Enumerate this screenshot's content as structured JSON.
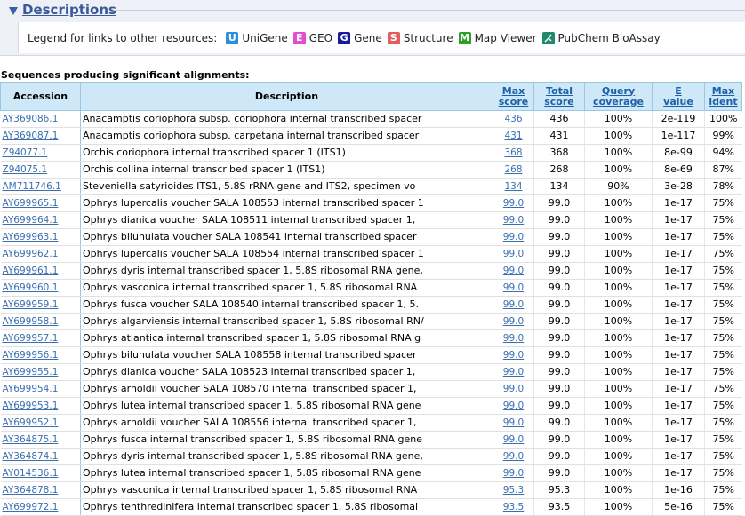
{
  "section": {
    "title": "Descriptions"
  },
  "legend": {
    "label": "Legend for links to other resources:",
    "items": [
      {
        "letter": "U",
        "label": "UniGene",
        "color": "#2b8fe0"
      },
      {
        "letter": "E",
        "label": "GEO",
        "color": "#e04fd0"
      },
      {
        "letter": "G",
        "label": "Gene",
        "color": "#1a1a9c"
      },
      {
        "letter": "S",
        "label": "Structure",
        "color": "#e25d5d"
      },
      {
        "letter": "M",
        "label": "Map Viewer",
        "color": "#2aa02a"
      },
      {
        "letter": "",
        "label": "PubChem BioAssay",
        "color": "#1f8a6a"
      }
    ]
  },
  "significant_title": "Sequences producing significant alignments:",
  "columns": {
    "accession": "Accession",
    "description": "Description",
    "max_score": [
      "Max",
      "score"
    ],
    "total_score": [
      "Total",
      "score"
    ],
    "query_coverage": [
      "Query",
      "coverage"
    ],
    "e_value": [
      "E",
      "value"
    ],
    "max_ident": [
      "Max",
      "ident"
    ]
  },
  "rows": [
    {
      "acc": "AY369086.1",
      "desc": "Anacamptis coriophora subsp. coriophora internal transcribed spacer",
      "max": "436",
      "total": "436",
      "cov": "100%",
      "e": "2e-119",
      "ident": "100%"
    },
    {
      "acc": "AY369087.1",
      "desc": "Anacamptis coriophora subsp. carpetana internal transcribed spacer",
      "max": "431",
      "total": "431",
      "cov": "100%",
      "e": "1e-117",
      "ident": "99%"
    },
    {
      "acc": "Z94077.1",
      "desc": "Orchis coriophora internal transcribed spacer 1 (ITS1)",
      "max": "368",
      "total": "368",
      "cov": "100%",
      "e": "8e-99",
      "ident": "94%"
    },
    {
      "acc": "Z94075.1",
      "desc": "Orchis collina internal transcribed spacer 1 (ITS1)",
      "max": "268",
      "total": "268",
      "cov": "100%",
      "e": "8e-69",
      "ident": "87%"
    },
    {
      "acc": "AM711746.1",
      "desc": "Steveniella satyrioides ITS1, 5.8S rRNA gene and ITS2, specimen vo",
      "max": "134",
      "total": "134",
      "cov": "90%",
      "e": "3e-28",
      "ident": "78%"
    },
    {
      "acc": "AY699965.1",
      "desc": "Ophrys lupercalis voucher SALA 108553 internal transcribed spacer 1",
      "max": "99.0",
      "total": "99.0",
      "cov": "100%",
      "e": "1e-17",
      "ident": "75%"
    },
    {
      "acc": "AY699964.1",
      "desc": "Ophrys dianica voucher SALA 108511 internal transcribed spacer 1,",
      "max": "99.0",
      "total": "99.0",
      "cov": "100%",
      "e": "1e-17",
      "ident": "75%"
    },
    {
      "acc": "AY699963.1",
      "desc": "Ophrys bilunulata voucher SALA 108541 internal transcribed spacer",
      "max": "99.0",
      "total": "99.0",
      "cov": "100%",
      "e": "1e-17",
      "ident": "75%"
    },
    {
      "acc": "AY699962.1",
      "desc": "Ophrys lupercalis voucher SALA 108554 internal transcribed spacer 1",
      "max": "99.0",
      "total": "99.0",
      "cov": "100%",
      "e": "1e-17",
      "ident": "75%"
    },
    {
      "acc": "AY699961.1",
      "desc": "Ophrys dyris internal transcribed spacer 1, 5.8S ribosomal RNA gene,",
      "max": "99.0",
      "total": "99.0",
      "cov": "100%",
      "e": "1e-17",
      "ident": "75%"
    },
    {
      "acc": "AY699960.1",
      "desc": "Ophrys vasconica internal transcribed spacer 1, 5.8S ribosomal RNA",
      "max": "99.0",
      "total": "99.0",
      "cov": "100%",
      "e": "1e-17",
      "ident": "75%"
    },
    {
      "acc": "AY699959.1",
      "desc": "Ophrys fusca voucher SALA 108540 internal transcribed spacer 1, 5.",
      "max": "99.0",
      "total": "99.0",
      "cov": "100%",
      "e": "1e-17",
      "ident": "75%"
    },
    {
      "acc": "AY699958.1",
      "desc": "Ophrys algarviensis internal transcribed spacer 1, 5.8S ribosomal RN/",
      "max": "99.0",
      "total": "99.0",
      "cov": "100%",
      "e": "1e-17",
      "ident": "75%"
    },
    {
      "acc": "AY699957.1",
      "desc": "Ophrys atlantica internal transcribed spacer 1, 5.8S ribosomal RNA g",
      "max": "99.0",
      "total": "99.0",
      "cov": "100%",
      "e": "1e-17",
      "ident": "75%"
    },
    {
      "acc": "AY699956.1",
      "desc": "Ophrys bilunulata voucher SALA 108558 internal transcribed spacer",
      "max": "99.0",
      "total": "99.0",
      "cov": "100%",
      "e": "1e-17",
      "ident": "75%"
    },
    {
      "acc": "AY699955.1",
      "desc": "Ophrys dianica voucher SALA 108523 internal transcribed spacer 1,",
      "max": "99.0",
      "total": "99.0",
      "cov": "100%",
      "e": "1e-17",
      "ident": "75%"
    },
    {
      "acc": "AY699954.1",
      "desc": "Ophrys arnoldii voucher SALA 108570 internal transcribed spacer 1,",
      "max": "99.0",
      "total": "99.0",
      "cov": "100%",
      "e": "1e-17",
      "ident": "75%"
    },
    {
      "acc": "AY699953.1",
      "desc": "Ophrys lutea internal transcribed spacer 1, 5.8S ribosomal RNA gene",
      "max": "99.0",
      "total": "99.0",
      "cov": "100%",
      "e": "1e-17",
      "ident": "75%"
    },
    {
      "acc": "AY699952.1",
      "desc": "Ophrys arnoldii voucher SALA 108556 internal transcribed spacer 1,",
      "max": "99.0",
      "total": "99.0",
      "cov": "100%",
      "e": "1e-17",
      "ident": "75%"
    },
    {
      "acc": "AY364875.1",
      "desc": "Ophrys fusca internal transcribed spacer 1, 5.8S ribosomal RNA gene",
      "max": "99.0",
      "total": "99.0",
      "cov": "100%",
      "e": "1e-17",
      "ident": "75%"
    },
    {
      "acc": "AY364874.1",
      "desc": "Ophrys dyris internal transcribed spacer 1, 5.8S ribosomal RNA gene,",
      "max": "99.0",
      "total": "99.0",
      "cov": "100%",
      "e": "1e-17",
      "ident": "75%"
    },
    {
      "acc": "AY014536.1",
      "desc": "Ophrys lutea internal transcribed spacer 1, 5.8S ribosomal RNA gene",
      "max": "99.0",
      "total": "99.0",
      "cov": "100%",
      "e": "1e-17",
      "ident": "75%"
    },
    {
      "acc": "AY364878.1",
      "desc": "Ophrys vasconica internal transcribed spacer 1, 5.8S ribosomal RNA",
      "max": "95.3",
      "total": "95.3",
      "cov": "100%",
      "e": "1e-16",
      "ident": "75%"
    },
    {
      "acc": "AY699972.1",
      "desc": "Ophrys tenthredinifera internal transcribed spacer 1, 5.8S ribosomal",
      "max": "93.5",
      "total": "93.5",
      "cov": "100%",
      "e": "5e-16",
      "ident": "75%"
    }
  ]
}
